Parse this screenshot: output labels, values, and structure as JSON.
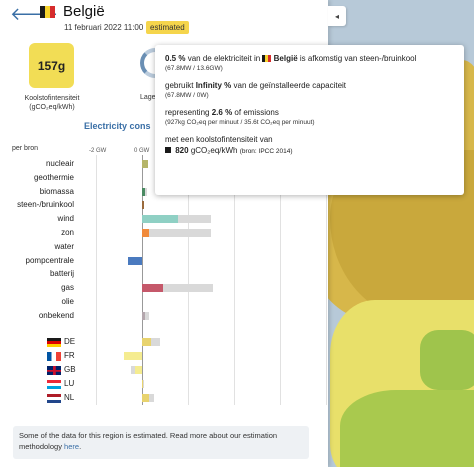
{
  "header": {
    "country": "België",
    "datetime": "11 februari 2022 11:00",
    "badge": "estimated",
    "collapse_icon": "◂",
    "back_icon": "🡐"
  },
  "carbon_intensity": {
    "value": "157g",
    "label_line1": "Koolstofintensiteit",
    "label_line2": "(gCO₂eq/kWh)"
  },
  "low_carbon": {
    "label": "Lage"
  },
  "chart": {
    "title": "Electricity cons",
    "per_bron_label": "per bron",
    "tick_neg": "-2 GW",
    "tick_zero": "0 GW"
  },
  "chart_data": {
    "type": "bar",
    "orientation": "horizontal",
    "categories": [
      "nucleair",
      "geothermie",
      "biomassa",
      "steen-/bruinkool",
      "wind",
      "zon",
      "water",
      "pompcentrale",
      "batterij",
      "gas",
      "olie",
      "onbekend"
    ],
    "series": [
      {
        "values": [
          0.25,
          0,
          0.15,
          0.07,
          1.55,
          0.32,
          0,
          -0.6,
          0,
          0.9,
          0,
          0.15
        ]
      },
      {
        "values": [
          0.25,
          0,
          0.2,
          0.1,
          3.0,
          3.0,
          0,
          -0.6,
          0,
          3.1,
          0,
          0.3
        ]
      }
    ],
    "exchange_categories": [
      "DE",
      "FR",
      "GB",
      "LU",
      "NL"
    ],
    "exchange_values": [
      0.4,
      -0.8,
      -0.3,
      0.05,
      0.3
    ],
    "exchange_capacity": [
      0.8,
      -0.8,
      -0.5,
      0.1,
      0.5
    ],
    "colors": {
      "nucleair": "#b5b56a",
      "biomassa": "#4a8a62",
      "steen-/bruinkool": "#9a6a3c",
      "wind": "#8fd0c4",
      "zon": "#f08a3b",
      "pompcentrale": "#4a7abf",
      "gas": "#c5586a",
      "olie": "#6b6b6b",
      "onbekend": "#b4a7ad",
      "capacity": "#d9d9d9",
      "exchange_positive": "#e8d36e",
      "exchange_negative": "#f5ec90"
    }
  },
  "tooltip": {
    "line1_pct": "0.5 %",
    "line1_text_a": "van de elektriciteit in",
    "line1_country": "België",
    "line1_text_b": "is afkomstig van steen-/bruinkool",
    "line1_sub": "(67.8MW / 13.6GW)",
    "line2_text_a": "gebruikt",
    "line2_value": "Infinity %",
    "line2_text_b": "van de geïnstalleerde capaciteit",
    "line2_sub": "(67.8MW / 0W)",
    "line3_text_a": "representing",
    "line3_value": "2.6 %",
    "line3_text_b": "of emissions",
    "line3_sub": "(927kg CO₂eq per minuut / 35.6t CO₂eq per minuut)",
    "line4_text": "met een koolstofintensiteit van",
    "line4_value": "820",
    "line4_unit": "gCO₂eq/kWh",
    "line4_source": "(bron: IPCC 2014)"
  },
  "note": {
    "text": "Some of the data for this region is estimated. Read more about our estimation methodology",
    "link": "here",
    "end": "."
  }
}
